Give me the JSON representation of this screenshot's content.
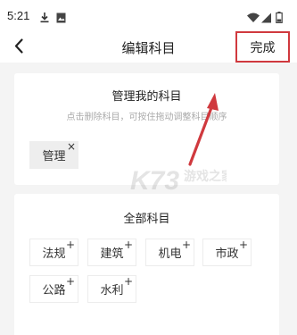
{
  "status_bar": {
    "time": "5:21",
    "icons": [
      "download-icon",
      "photo-icon",
      "wifi-icon",
      "signal-icon",
      "battery-icon"
    ]
  },
  "header": {
    "back_icon": "chevron-left-icon",
    "title": "编辑科目",
    "done_label": "完成",
    "highlight_color": "#d0393e"
  },
  "my_subjects": {
    "title": "管理我的科目",
    "hint": "点击删除科目，可按住拖动调整科目顺序",
    "items": [
      {
        "label": "管理",
        "mark": "×"
      }
    ]
  },
  "all_subjects": {
    "title": "全部科目",
    "items": [
      {
        "label": "法规",
        "mark": "+"
      },
      {
        "label": "建筑",
        "mark": "+"
      },
      {
        "label": "机电",
        "mark": "+"
      },
      {
        "label": "市政",
        "mark": "+"
      },
      {
        "label": "公路",
        "mark": "+"
      },
      {
        "label": "水利",
        "mark": "+"
      }
    ]
  },
  "watermark": {
    "brand": "K73",
    "site": "游戏之家",
    "domain": ".com"
  },
  "annotation": {
    "arrow_color": "#d0393e"
  }
}
